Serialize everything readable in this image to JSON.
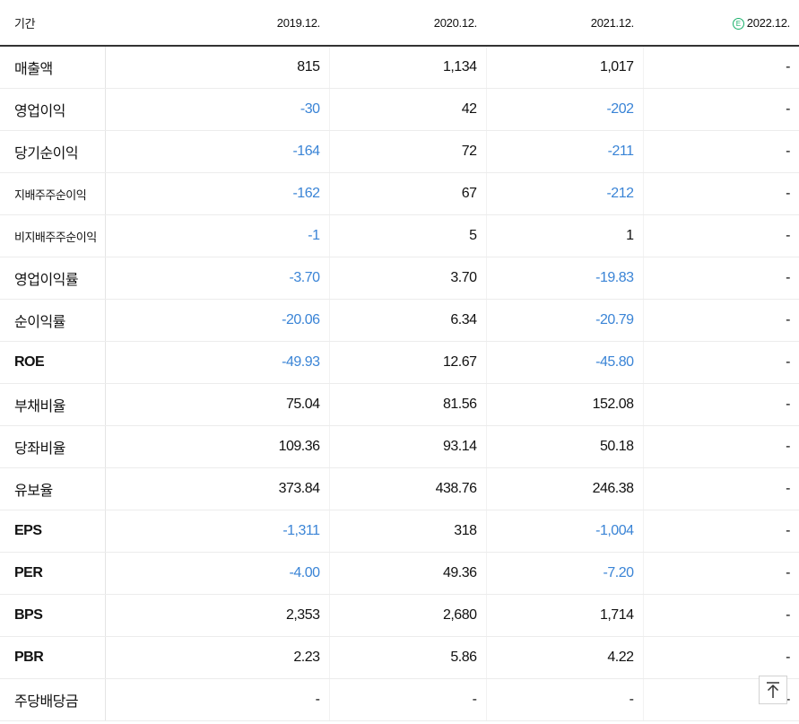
{
  "table": {
    "header": {
      "label": "기간",
      "periods": [
        "2019.12.",
        "2020.12.",
        "2021.12.",
        "2022.12."
      ],
      "estimate_badge": "E"
    },
    "rows": [
      {
        "label": "매출액",
        "values": [
          "815",
          "1,134",
          "1,017",
          "-"
        ]
      },
      {
        "label": "영업이익",
        "values": [
          "-30",
          "42",
          "-202",
          "-"
        ]
      },
      {
        "label": "당기순이익",
        "values": [
          "-164",
          "72",
          "-211",
          "-"
        ]
      },
      {
        "label": "지배주주순이익",
        "values": [
          "-162",
          "67",
          "-212",
          "-"
        ]
      },
      {
        "label": "비지배주주순이익",
        "values": [
          "-1",
          "5",
          "1",
          "-"
        ]
      },
      {
        "label": "영업이익률",
        "values": [
          "-3.70",
          "3.70",
          "-19.83",
          "-"
        ]
      },
      {
        "label": "순이익률",
        "values": [
          "-20.06",
          "6.34",
          "-20.79",
          "-"
        ]
      },
      {
        "label": "ROE",
        "values": [
          "-49.93",
          "12.67",
          "-45.80",
          "-"
        ]
      },
      {
        "label": "부채비율",
        "values": [
          "75.04",
          "81.56",
          "152.08",
          "-"
        ]
      },
      {
        "label": "당좌비율",
        "values": [
          "109.36",
          "93.14",
          "50.18",
          "-"
        ]
      },
      {
        "label": "유보율",
        "values": [
          "373.84",
          "438.76",
          "246.38",
          "-"
        ]
      },
      {
        "label": "EPS",
        "values": [
          "-1,311",
          "318",
          "-1,004",
          "-"
        ]
      },
      {
        "label": "PER",
        "values": [
          "-4.00",
          "49.36",
          "-7.20",
          "-"
        ]
      },
      {
        "label": "BPS",
        "values": [
          "2,353",
          "2,680",
          "1,714",
          "-"
        ]
      },
      {
        "label": "PBR",
        "values": [
          "2.23",
          "5.86",
          "4.22",
          "-"
        ]
      },
      {
        "label": "주당배당금",
        "values": [
          "-",
          "-",
          "-",
          "-"
        ]
      }
    ]
  },
  "colors": {
    "negative": "#3a84d6",
    "estimate": "#19b06a"
  },
  "icons": {
    "scroll_top": "arrow-up-to-line-icon"
  }
}
